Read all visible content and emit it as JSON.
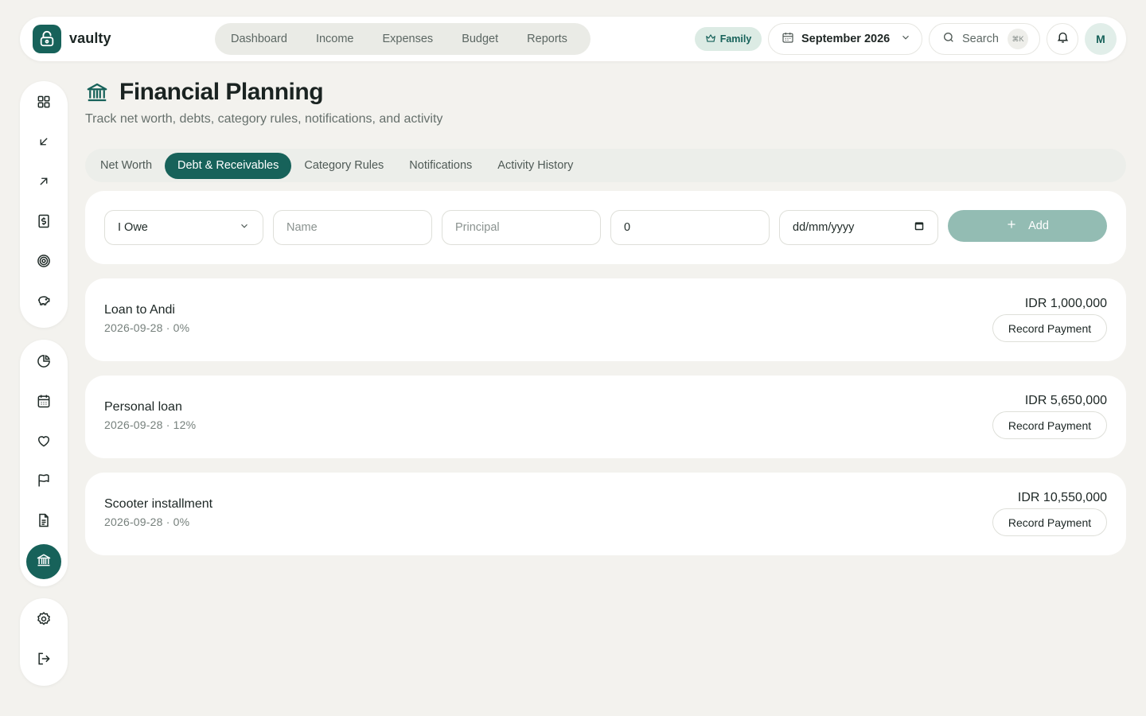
{
  "app": {
    "brand": "vaulty"
  },
  "nav": [
    {
      "label": "Dashboard"
    },
    {
      "label": "Income"
    },
    {
      "label": "Expenses"
    },
    {
      "label": "Budget"
    },
    {
      "label": "Reports"
    }
  ],
  "header": {
    "family_badge": "Family",
    "month": "September 2026",
    "search_label": "Search",
    "search_shortcut": "⌘K",
    "avatar_initial": "M"
  },
  "page": {
    "title": "Financial Planning",
    "subtitle": "Track net worth, debts, category rules, notifications, and activity"
  },
  "tabs": [
    {
      "label": "Net Worth",
      "active": false
    },
    {
      "label": "Debt & Receivables",
      "active": true
    },
    {
      "label": "Category Rules",
      "active": false
    },
    {
      "label": "Notifications",
      "active": false
    },
    {
      "label": "Activity History",
      "active": false
    }
  ],
  "form": {
    "type_value": "I Owe",
    "name_placeholder": "Name",
    "principal_placeholder": "Principal",
    "rate_value": "0",
    "date_placeholder": "dd/mm/yyyy",
    "add_label": "Add"
  },
  "debts": [
    {
      "name": "Loan to Andi",
      "meta": "2026-09-28 · 0%",
      "amount": "IDR 1,000,000",
      "action": "Record Payment"
    },
    {
      "name": "Personal loan",
      "meta": "2026-09-28 · 12%",
      "amount": "IDR 5,650,000",
      "action": "Record Payment"
    },
    {
      "name": "Scooter installment",
      "meta": "2026-09-28 · 0%",
      "amount": "IDR 10,550,000",
      "action": "Record Payment"
    }
  ],
  "sidebar": {
    "group1": [
      "grid-icon",
      "arrow-down-left-icon",
      "arrow-up-right-icon",
      "receipt-dollar-icon",
      "target-icon",
      "piggy-bank-icon"
    ],
    "group2": [
      "pie-chart-icon",
      "calendar-icon",
      "heart-icon",
      "flag-icon",
      "document-icon",
      "bank-icon"
    ],
    "group3": [
      "settings-icon",
      "logout-icon"
    ],
    "active": "bank-icon"
  },
  "colors": {
    "accent": "#17625a",
    "background": "#f3f2ee",
    "add_button": "#93bcb3"
  }
}
